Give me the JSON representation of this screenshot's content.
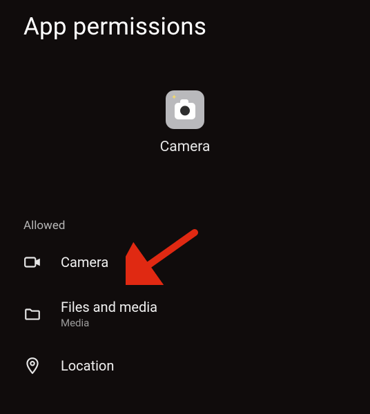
{
  "header": {
    "title": "App permissions"
  },
  "app": {
    "name": "Camera"
  },
  "sections": {
    "allowed": {
      "header": "Allowed",
      "items": [
        {
          "label": "Camera",
          "sub": ""
        },
        {
          "label": "Files and media",
          "sub": "Media"
        },
        {
          "label": "Location",
          "sub": ""
        }
      ]
    }
  },
  "annotation": {
    "color": "#e02912"
  }
}
